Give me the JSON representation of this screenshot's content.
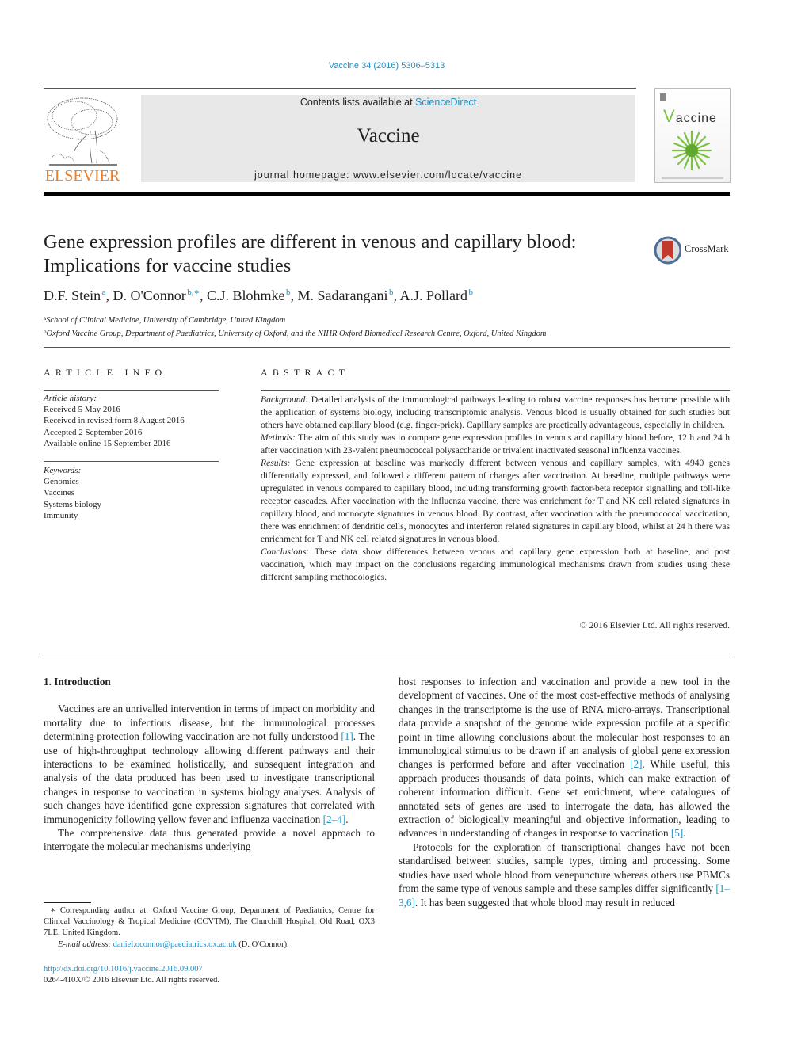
{
  "header": {
    "citation": "Vaccine 34 (2016) 5306–5313",
    "publisher_logo_text": "ELSEVIER",
    "contents_prefix": "Contents lists available at ",
    "contents_link": "ScienceDirect",
    "journal_name": "Vaccine",
    "homepage_label": "journal homepage: ",
    "homepage_url": "www.elsevier.com/locate/vaccine",
    "cover_title_first": "V",
    "cover_title_rest": "accine",
    "crossmark_label": "CrossMark"
  },
  "article": {
    "title": "Gene expression profiles are different in venous and capillary blood: Implications for vaccine studies",
    "authors": [
      {
        "name": "D.F. Stein",
        "sup": "a"
      },
      {
        "name": "D. O'Connor",
        "sup": "b,∗"
      },
      {
        "name": "C.J. Blohmke",
        "sup": "b"
      },
      {
        "name": "M. Sadarangani",
        "sup": "b"
      },
      {
        "name": "A.J. Pollard",
        "sup": "b"
      }
    ],
    "affiliations": [
      {
        "sup": "a",
        "text": "School of Clinical Medicine, University of Cambridge, United Kingdom"
      },
      {
        "sup": "b",
        "text": "Oxford Vaccine Group, Department of Paediatrics, University of Oxford, and the NIHR Oxford Biomedical Research Centre, Oxford, United Kingdom"
      }
    ]
  },
  "article_info": {
    "heading": "ARTICLE INFO",
    "history_label": "Article history:",
    "history": [
      "Received 5 May 2016",
      "Received in revised form 8 August 2016",
      "Accepted 2 September 2016",
      "Available online 15 September 2016"
    ],
    "keywords_label": "Keywords:",
    "keywords": [
      "Genomics",
      "Vaccines",
      "Systems biology",
      "Immunity"
    ]
  },
  "abstract": {
    "heading": "ABSTRACT",
    "sections": [
      {
        "label": "Background:",
        "text": " Detailed analysis of the immunological pathways leading to robust vaccine responses has become possible with the application of systems biology, including transcriptomic analysis. Venous blood is usually obtained for such studies but others have obtained capillary blood (e.g. finger-prick). Capillary samples are practically advantageous, especially in children."
      },
      {
        "label": "Methods:",
        "text": " The aim of this study was to compare gene expression profiles in venous and capillary blood before, 12 h and 24 h after vaccination with 23-valent pneumococcal polysaccharide or trivalent inactivated seasonal influenza vaccines."
      },
      {
        "label": "Results:",
        "text": " Gene expression at baseline was markedly different between venous and capillary samples, with 4940 genes differentially expressed, and followed a different pattern of changes after vaccination. At baseline, multiple pathways were upregulated in venous compared to capillary blood, including transforming growth factor-beta receptor signalling and toll-like receptor cascades. After vaccination with the influenza vaccine, there was enrichment for T and NK cell related signatures in capillary blood, and monocyte signatures in venous blood. By contrast, after vaccination with the pneumococcal vaccination, there was enrichment of dendritic cells, monocytes and interferon related signatures in capillary blood, whilst at 24 h there was enrichment for T and NK cell related signatures in venous blood."
      },
      {
        "label": "Conclusions:",
        "text": " These data show differences between venous and capillary gene expression both at baseline, and post vaccination, which may impact on the conclusions regarding immunological mechanisms drawn from studies using these different sampling methodologies."
      }
    ],
    "copyright": "© 2016 Elsevier Ltd. All rights reserved."
  },
  "body": {
    "section_heading": "1. Introduction",
    "left": {
      "p1_a": "Vaccines are an unrivalled intervention in terms of impact on morbidity and mortality due to infectious disease, but the immunological processes determining protection following vaccination are not fully understood ",
      "p1_ref1": "[1]",
      "p1_b": ". The use of high-throughput technology allowing different pathways and their interactions to be examined holistically, and subsequent integration and analysis of the data produced has been used to investigate transcriptional changes in response to vaccination in systems biology analyses. Analysis of such changes have identified gene expression signatures that correlated with immunogenicity following yellow fever and influenza vaccination ",
      "p1_ref2": "[2–4]",
      "p1_c": ".",
      "p2": "The comprehensive data thus generated provide a novel approach to interrogate the molecular mechanisms underlying"
    },
    "right": {
      "p1_a": "host responses to infection and vaccination and provide a new tool in the development of vaccines. One of the most cost-effective methods of analysing changes in the transcriptome is the use of RNA micro-arrays. Transcriptional data provide a snapshot of the genome wide expression profile at a specific point in time allowing conclusions about the molecular host responses to an immunological stimulus to be drawn if an analysis of global gene expression changes is performed before and after vaccination ",
      "p1_ref1": "[2]",
      "p1_b": ". While useful, this approach produces thousands of data points, which can make extraction of coherent information difficult. Gene set enrichment, where catalogues of annotated sets of genes are used to interrogate the data, has allowed the extraction of biologically meaningful and objective information, leading to advances in understanding of changes in response to vaccination ",
      "p1_ref2": "[5]",
      "p1_c": ".",
      "p2_a": "Protocols for the exploration of transcriptional changes have not been standardised between studies, sample types, timing and processing. Some studies have used whole blood from venepuncture whereas others use PBMCs from the same type of venous sample and these samples differ significantly ",
      "p2_ref": "[1–3,6]",
      "p2_b": ". It has been suggested that whole blood may result in reduced"
    }
  },
  "footnote": {
    "corresponding": "∗ Corresponding author at: Oxford Vaccine Group, Department of Paediatrics, Centre for Clinical Vaccinology & Tropical Medicine (CCVTM), The Churchill Hospital, Old Road, OX3 7LE, United Kingdom.",
    "email_label": "E-mail address: ",
    "email": "daniel.oconnor@paediatrics.ox.ac.uk",
    "email_suffix": " (D. O'Connor).",
    "doi": "http://dx.doi.org/10.1016/j.vaccine.2016.09.007",
    "issn": "0264-410X/© 2016 Elsevier Ltd. All rights reserved."
  }
}
